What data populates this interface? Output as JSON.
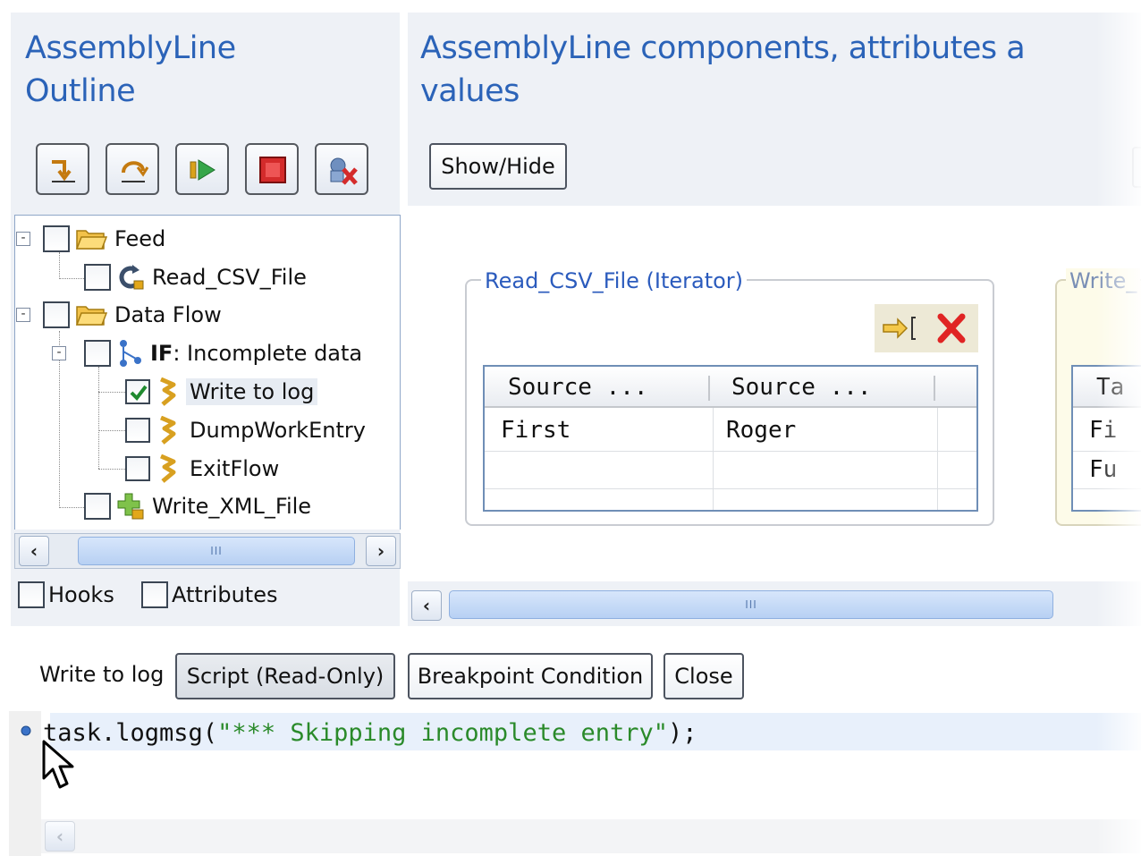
{
  "left_panel": {
    "title_line1": "AssemblyLine",
    "title_line2": "Outline",
    "toolbar": [
      {
        "name": "step-into-icon"
      },
      {
        "name": "step-over-icon"
      },
      {
        "name": "run-icon"
      },
      {
        "name": "stop-icon"
      },
      {
        "name": "disconnect-icon"
      }
    ],
    "tree": {
      "feed": "Feed",
      "read_csv": "Read_CSV_File",
      "data_flow": "Data Flow",
      "if_keyword": "IF",
      "if_label": ": Incomplete data",
      "write_to_log": "Write to log",
      "dump_work_entry": "DumpWorkEntry",
      "exit_flow": "ExitFlow",
      "write_xml": "Write_XML_File",
      "write_to_log_checked": true
    },
    "scroll_thumb": "III",
    "hooks_label": "Hooks",
    "attributes_label": "Attributes"
  },
  "right_panel": {
    "title_line1": "AssemblyLine components, attributes a",
    "title_line2": "values",
    "show_hide": "Show/Hide",
    "read_group": {
      "title": "Read_CSV_File (Iterator)",
      "columns": [
        "Source ...",
        "Source ..."
      ],
      "rows": [
        [
          "First",
          "Roger"
        ],
        [
          "",
          ""
        ]
      ]
    },
    "write_group": {
      "title": "Write_",
      "column": "Ta",
      "rows": [
        "Fi",
        "Fu"
      ]
    },
    "scroll_thumb": "III"
  },
  "bottom": {
    "label": "Write to log",
    "script_button": "Script (Read-Only)",
    "breakpoint_button": "Breakpoint Condition",
    "close_button": "Close",
    "code_prefix": "task.logmsg(",
    "code_string": "\"*** Skipping incomplete entry\"",
    "code_suffix": ");"
  },
  "colors": {
    "heading": "#2b63b8",
    "panel": "#eef1f6",
    "group_title": "#2b5bbd",
    "code_string": "#2a8a2a"
  }
}
